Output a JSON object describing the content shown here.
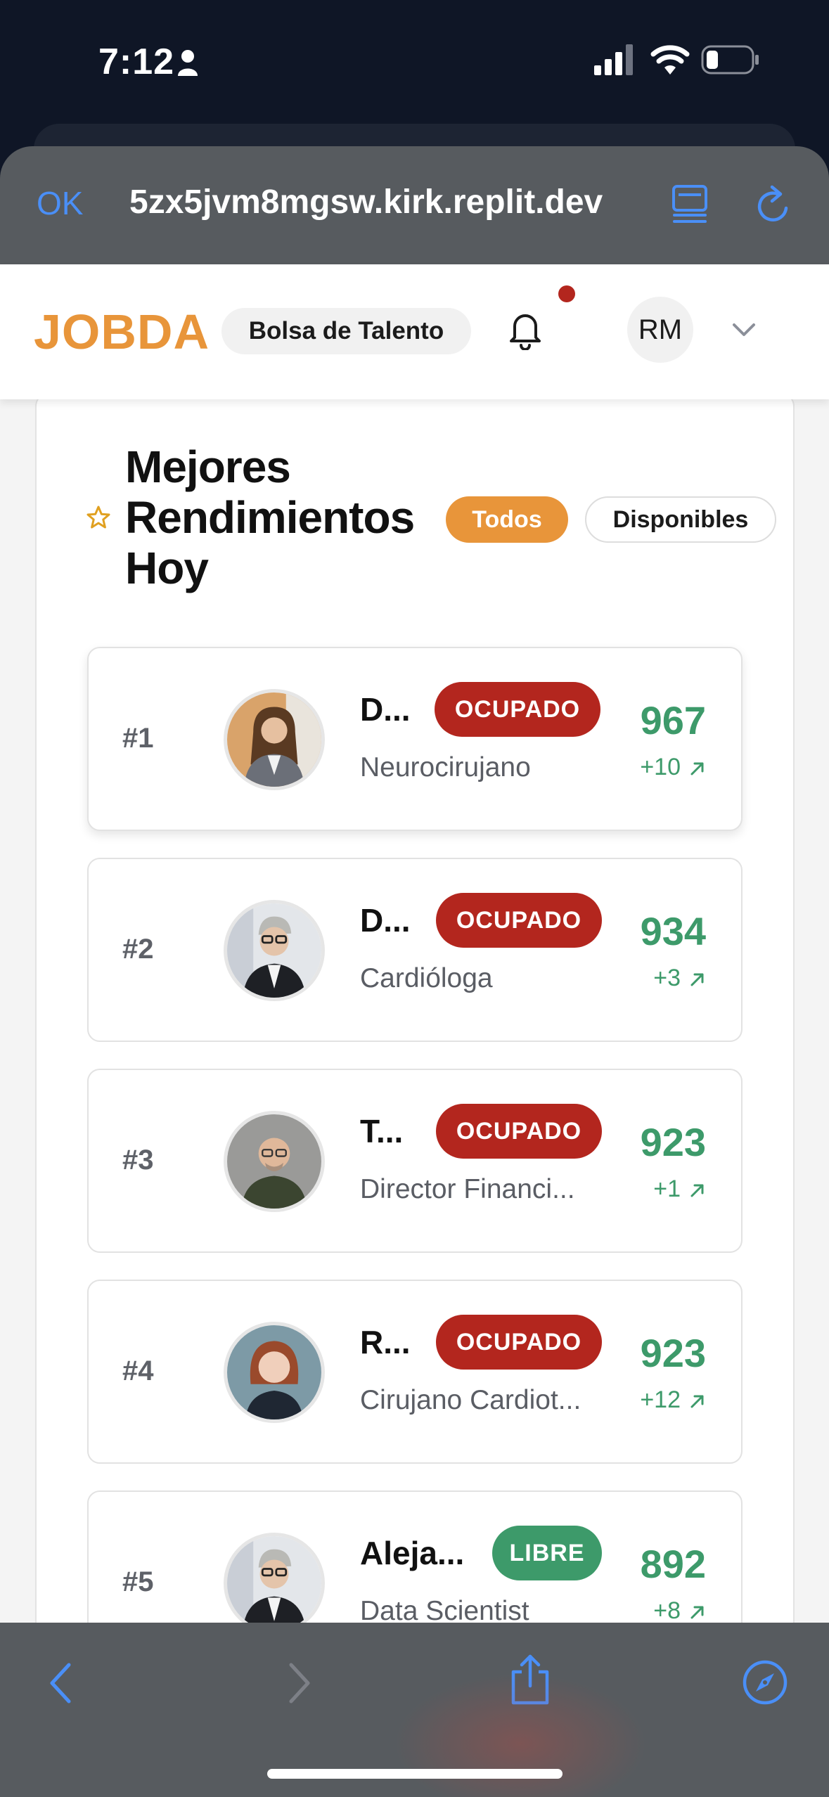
{
  "status_bar": {
    "time": "7:12"
  },
  "browser": {
    "ok_label": "OK",
    "url": "5zx5jvm8mgsw.kirk.replit.dev"
  },
  "header": {
    "logo": "JOBDA",
    "tag": "Bolsa de Talento",
    "avatar_initials": "RM"
  },
  "section": {
    "title": "Mejores Rendimientos Hoy",
    "filters": {
      "all": "Todos",
      "available": "Disponibles"
    },
    "active_filter": "Todos"
  },
  "ranking": [
    {
      "rank": "#1",
      "name": "D...",
      "status": "OCUPADO",
      "job": "Neurocirujano",
      "score": "967",
      "delta": "+10"
    },
    {
      "rank": "#2",
      "name": "D...",
      "status": "OCUPADO",
      "job": "Cardióloga",
      "score": "934",
      "delta": "+3"
    },
    {
      "rank": "#3",
      "name": "T...",
      "status": "OCUPADO",
      "job": "Director Financi...",
      "score": "923",
      "delta": "+1"
    },
    {
      "rank": "#4",
      "name": "R...",
      "status": "OCUPADO",
      "job": "Cirujano Cardiot...",
      "score": "923",
      "delta": "+12"
    },
    {
      "rank": "#5",
      "name": "Aleja...",
      "status": "LIBRE",
      "job": "Data Scientist",
      "score": "892",
      "delta": "+8"
    }
  ],
  "colors": {
    "brand": "#e8953a",
    "busy": "#b3261e",
    "free": "#3d9a6a",
    "browser_accent": "#4a8ff7"
  },
  "icons": {
    "toolbar": [
      "back-icon",
      "forward-icon",
      "share-icon",
      "compass-icon"
    ]
  }
}
